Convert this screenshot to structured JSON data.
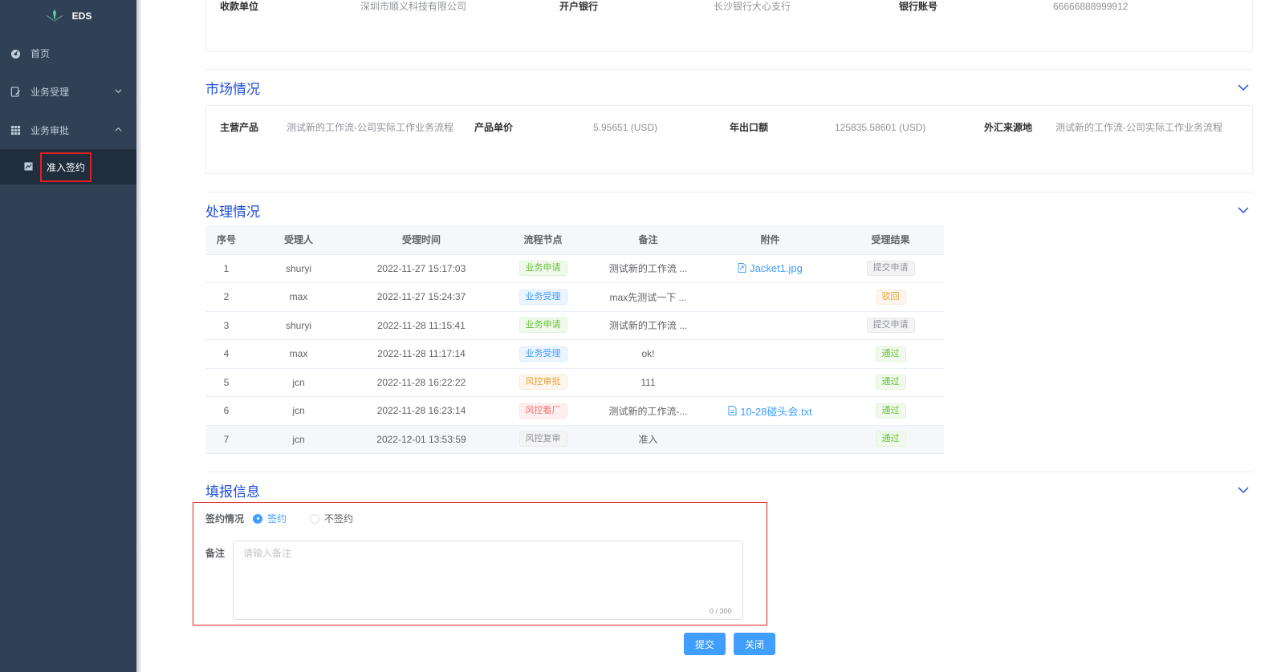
{
  "app": {
    "logo_text": "EDS"
  },
  "sidebar": {
    "items": [
      {
        "label": "首页"
      },
      {
        "label": "业务受理"
      },
      {
        "label": "业务审批"
      }
    ],
    "sub_item": {
      "label": "准入签约"
    }
  },
  "bank_info": [
    {
      "label": "收款单位",
      "value": "深圳市顺义科技有限公司"
    },
    {
      "label": "开户银行",
      "value": "长沙银行大心支行"
    },
    {
      "label": "银行账号",
      "value": "66666888999912"
    }
  ],
  "market": {
    "title": "市场情况",
    "fields": [
      {
        "label": "主营产品",
        "value": "测试新的工作流-公司实际工作业务流程"
      },
      {
        "label": "产品单价",
        "value": "5.95651 (USD)"
      },
      {
        "label": "年出口额",
        "value": "125835.58601 (USD)"
      },
      {
        "label": "外汇来源地",
        "value": "测试新的工作流-公司实际工作业务流程"
      }
    ]
  },
  "processing": {
    "title": "处理情况",
    "headers": [
      "序号",
      "受理人",
      "受理时间",
      "流程节点",
      "备注",
      "附件",
      "受理结果"
    ],
    "rows": [
      {
        "no": "1",
        "user": "shuryi",
        "time": "2022-11-27 15:17:03",
        "node": "业务申请",
        "node_color": "green",
        "note": "测试新的工作流 ...",
        "file": "Jacket1.jpg",
        "result": "提交申请",
        "result_color": "gray"
      },
      {
        "no": "2",
        "user": "max",
        "time": "2022-11-27 15:24:37",
        "node": "业务受理",
        "node_color": "blue",
        "note": "max先测试一下 ...",
        "file": "",
        "result": "驳回",
        "result_color": "orange"
      },
      {
        "no": "3",
        "user": "shuryi",
        "time": "2022-11-28 11:15:41",
        "node": "业务申请",
        "node_color": "green",
        "note": "测试新的工作流 ...",
        "file": "",
        "result": "提交申请",
        "result_color": "gray"
      },
      {
        "no": "4",
        "user": "max",
        "time": "2022-11-28 11:17:14",
        "node": "业务受理",
        "node_color": "blue",
        "note": "ok!",
        "file": "",
        "result": "通过",
        "result_color": "green"
      },
      {
        "no": "5",
        "user": "jcn",
        "time": "2022-11-28 16:22:22",
        "node": "风控审批",
        "node_color": "orange",
        "note": "111",
        "file": "",
        "result": "通过",
        "result_color": "green"
      },
      {
        "no": "6",
        "user": "jcn",
        "time": "2022-11-28 16:23:14",
        "node": "风控看厂",
        "node_color": "red",
        "note": "测试新的工作流-...",
        "file": "10-28碰头会.txt",
        "result": "通过",
        "result_color": "green"
      },
      {
        "no": "7",
        "user": "jcn",
        "time": "2022-12-01 13:53:59",
        "node": "风控复审",
        "node_color": "gray",
        "note": "准入",
        "file": "",
        "result": "通过",
        "result_color": "green"
      }
    ]
  },
  "form": {
    "title": "填报信息",
    "sign_label": "签约情况",
    "options": [
      {
        "label": "签约",
        "checked": true
      },
      {
        "label": "不签约",
        "checked": false
      }
    ],
    "note_label": "备注",
    "note_placeholder": "请输入备注",
    "note_value": "",
    "counter": "0 / 300"
  },
  "buttons": {
    "submit": "提交",
    "close": "关闭"
  }
}
